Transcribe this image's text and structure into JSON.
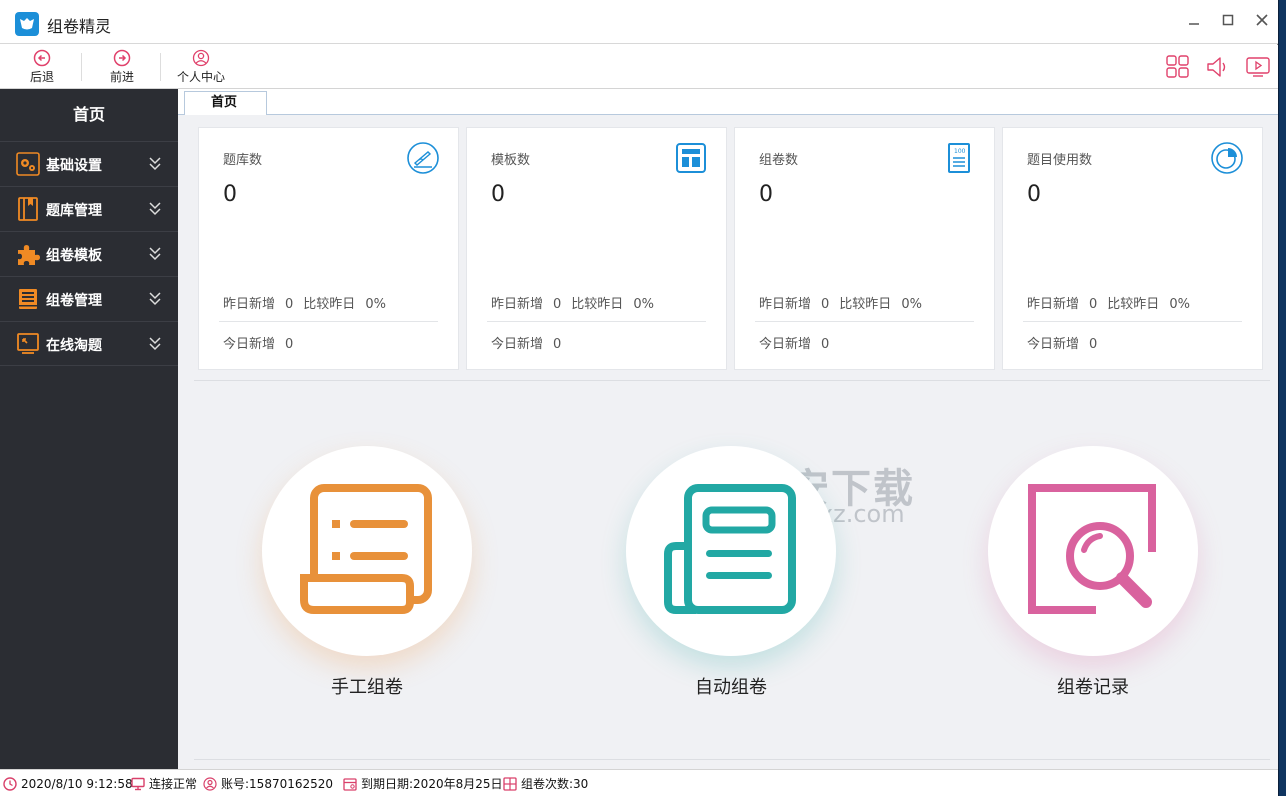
{
  "app": {
    "title": "组卷精灵"
  },
  "toolbar": {
    "back_label": "后退",
    "forward_label": "前进",
    "profile_label": "个人中心"
  },
  "sidebar": {
    "home_label": "首页",
    "items": [
      {
        "label": "基础设置",
        "icon": "gears-icon"
      },
      {
        "label": "题库管理",
        "icon": "book-icon"
      },
      {
        "label": "组卷模板",
        "icon": "puzzle-icon"
      },
      {
        "label": "组卷管理",
        "icon": "ledger-icon"
      },
      {
        "label": "在线淘题",
        "icon": "monitor-icon"
      }
    ]
  },
  "tabs": [
    {
      "label": "首页"
    }
  ],
  "cards": [
    {
      "title": "题库数",
      "value": "0",
      "yesterday_label": "昨日新增",
      "yesterday_value": "0",
      "compare_label": "比较昨日",
      "compare_value": "0%",
      "today_label": "今日新增",
      "today_value": "0",
      "icon": "pen-circle-icon"
    },
    {
      "title": "模板数",
      "value": "0",
      "yesterday_label": "昨日新增",
      "yesterday_value": "0",
      "compare_label": "比较昨日",
      "compare_value": "0%",
      "today_label": "今日新增",
      "today_value": "0",
      "icon": "layout-icon"
    },
    {
      "title": "组卷数",
      "value": "0",
      "yesterday_label": "昨日新增",
      "yesterday_value": "0",
      "compare_label": "比较昨日",
      "compare_value": "0%",
      "today_label": "今日新增",
      "today_value": "0",
      "icon": "score-sheet-icon"
    },
    {
      "title": "题目使用数",
      "value": "0",
      "yesterday_label": "昨日新增",
      "yesterday_value": "0",
      "compare_label": "比较昨日",
      "compare_value": "0%",
      "today_label": "今日新增",
      "today_value": "0",
      "icon": "pie-chart-icon"
    }
  ],
  "actions": [
    {
      "label": "手工组卷",
      "color": "#e8913a"
    },
    {
      "label": "自动组卷",
      "color": "#22a8a4"
    },
    {
      "label": "组卷记录",
      "color": "#d9629e"
    }
  ],
  "watermark": {
    "text": "安下载",
    "sub": "anxz.com"
  },
  "status": {
    "datetime": "2020/8/10 9:12:58",
    "connection": "连接正常",
    "account": "账号:15870162520",
    "expiry": "到期日期:2020年8月25日",
    "count": "组卷次数:30"
  },
  "colors": {
    "accent": "#1c8fd8",
    "sidebar_bg": "#2b2d33",
    "toolbar_icon": "#e0416b",
    "status_icon": "#d9406a"
  }
}
